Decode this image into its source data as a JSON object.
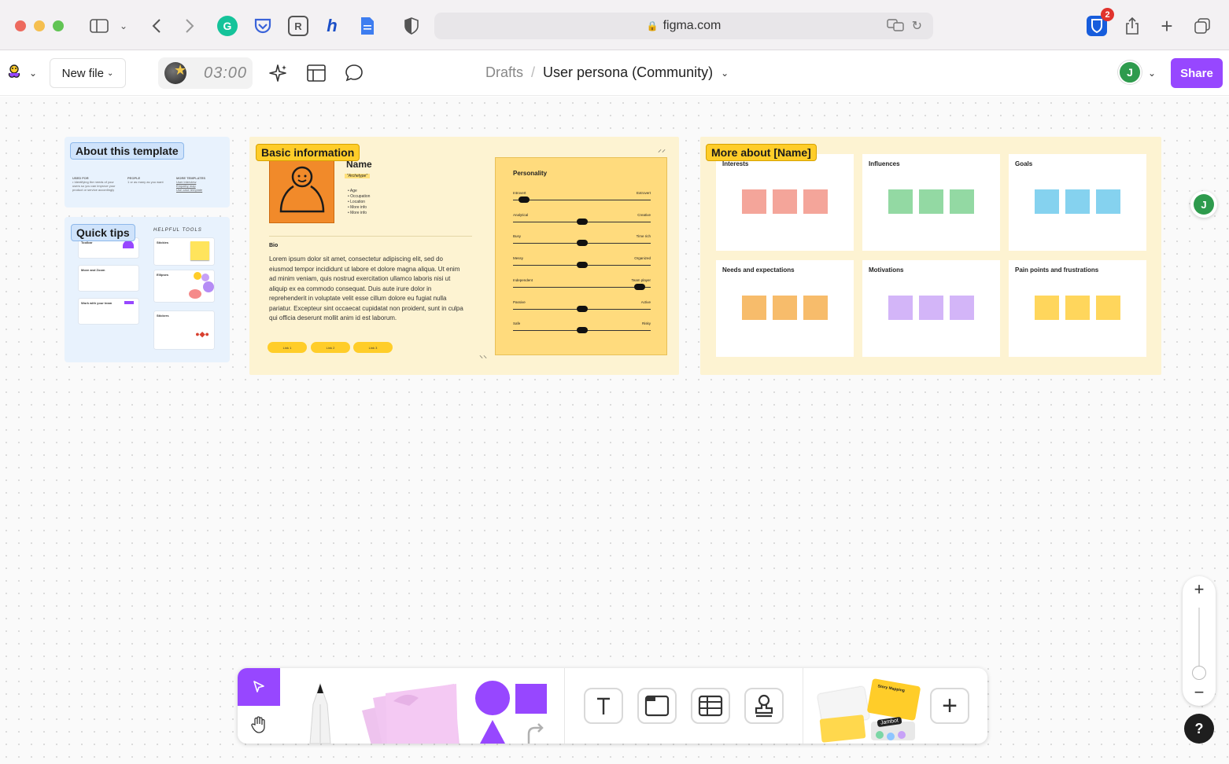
{
  "browser": {
    "url": "figma.com",
    "badge_count": "2"
  },
  "toolbar": {
    "new_file_label": "New file",
    "timer": "03:00",
    "breadcrumb_root": "Drafts",
    "breadcrumb_sep": "/",
    "file_name": "User persona (Community)",
    "avatar_initial": "J",
    "share_label": "Share"
  },
  "about": {
    "tag": "About this template",
    "col1_head": "USED FOR",
    "col1_text": "• Identifying the needs of your users so you can improve your product or service accordingly",
    "col2_head": "PEOPLE",
    "col2_text": "1 or as many as you want",
    "col3_head": "MORE TEMPLATES",
    "col3_items": [
      "User interview",
      "Empathy map",
      "Use case template"
    ]
  },
  "quick_tips": {
    "tag": "Quick tips",
    "helpful_tools": "HELPFUL TOOLS",
    "cards": [
      "Toolbar",
      "Move and Zoom",
      "Work with your team"
    ],
    "tools": [
      "Stickies",
      "Ellipses",
      "Stickers"
    ]
  },
  "basic_info": {
    "tag": "Basic information",
    "name": "Name",
    "archetype": "\"Archetype\"",
    "bullets": [
      "• Age",
      "• Occupation",
      "• Location",
      "• More info",
      "• More info"
    ],
    "bio_title": "Bio",
    "bio_text": "Lorem ipsum dolor sit amet, consectetur adipiscing elit, sed do eiusmod tempor incididunt ut labore et dolore magna aliqua. Ut enim ad minim veniam, quis nostrud exercitation ullamco laboris nisi ut aliquip ex ea commodo consequat. Duis aute irure dolor in reprehenderit in voluptate velit esse cillum dolore eu fugiat nulla pariatur. Excepteur sint occaecat cupidatat non proident, sunt in culpa qui officia deserunt mollit anim id est laborum.",
    "links": [
      "Link 1",
      "Link 2",
      "Link 3"
    ],
    "personality_title": "Personality",
    "traits": [
      {
        "left": "Introvert",
        "right": "Extrovert",
        "value": 0.08
      },
      {
        "left": "Analytical",
        "right": "Creative",
        "value": 0.5
      },
      {
        "left": "Busy",
        "right": "Time rich",
        "value": 0.5
      },
      {
        "left": "Messy",
        "right": "Organized",
        "value": 0.5
      },
      {
        "left": "Independent",
        "right": "Team player",
        "value": 0.92
      },
      {
        "left": "Passive",
        "right": "Active",
        "value": 0.5
      },
      {
        "left": "Safe",
        "right": "Risky",
        "value": 0.5
      }
    ]
  },
  "more_about": {
    "tag": "More about [Name]",
    "cards": [
      {
        "title": "Interests",
        "color": "#f4a59a"
      },
      {
        "title": "Influences",
        "color": "#93d9a3"
      },
      {
        "title": "Goals",
        "color": "#85d2ef"
      },
      {
        "title": "Needs and expectations",
        "color": "#f7bc6b"
      },
      {
        "title": "Motivations",
        "color": "#d3b5f8"
      },
      {
        "title": "Pain points and frustrations",
        "color": "#ffd65c"
      }
    ]
  },
  "side_avatar_initial": "J",
  "zoom": {
    "plus": "+",
    "minus": "−"
  },
  "help_label": "?",
  "bottom_tools": {
    "jambot_label": "Jambot",
    "story_label": "Story Mapping"
  },
  "colors": {
    "accent": "#9747ff",
    "canvas": "#fafafa"
  }
}
